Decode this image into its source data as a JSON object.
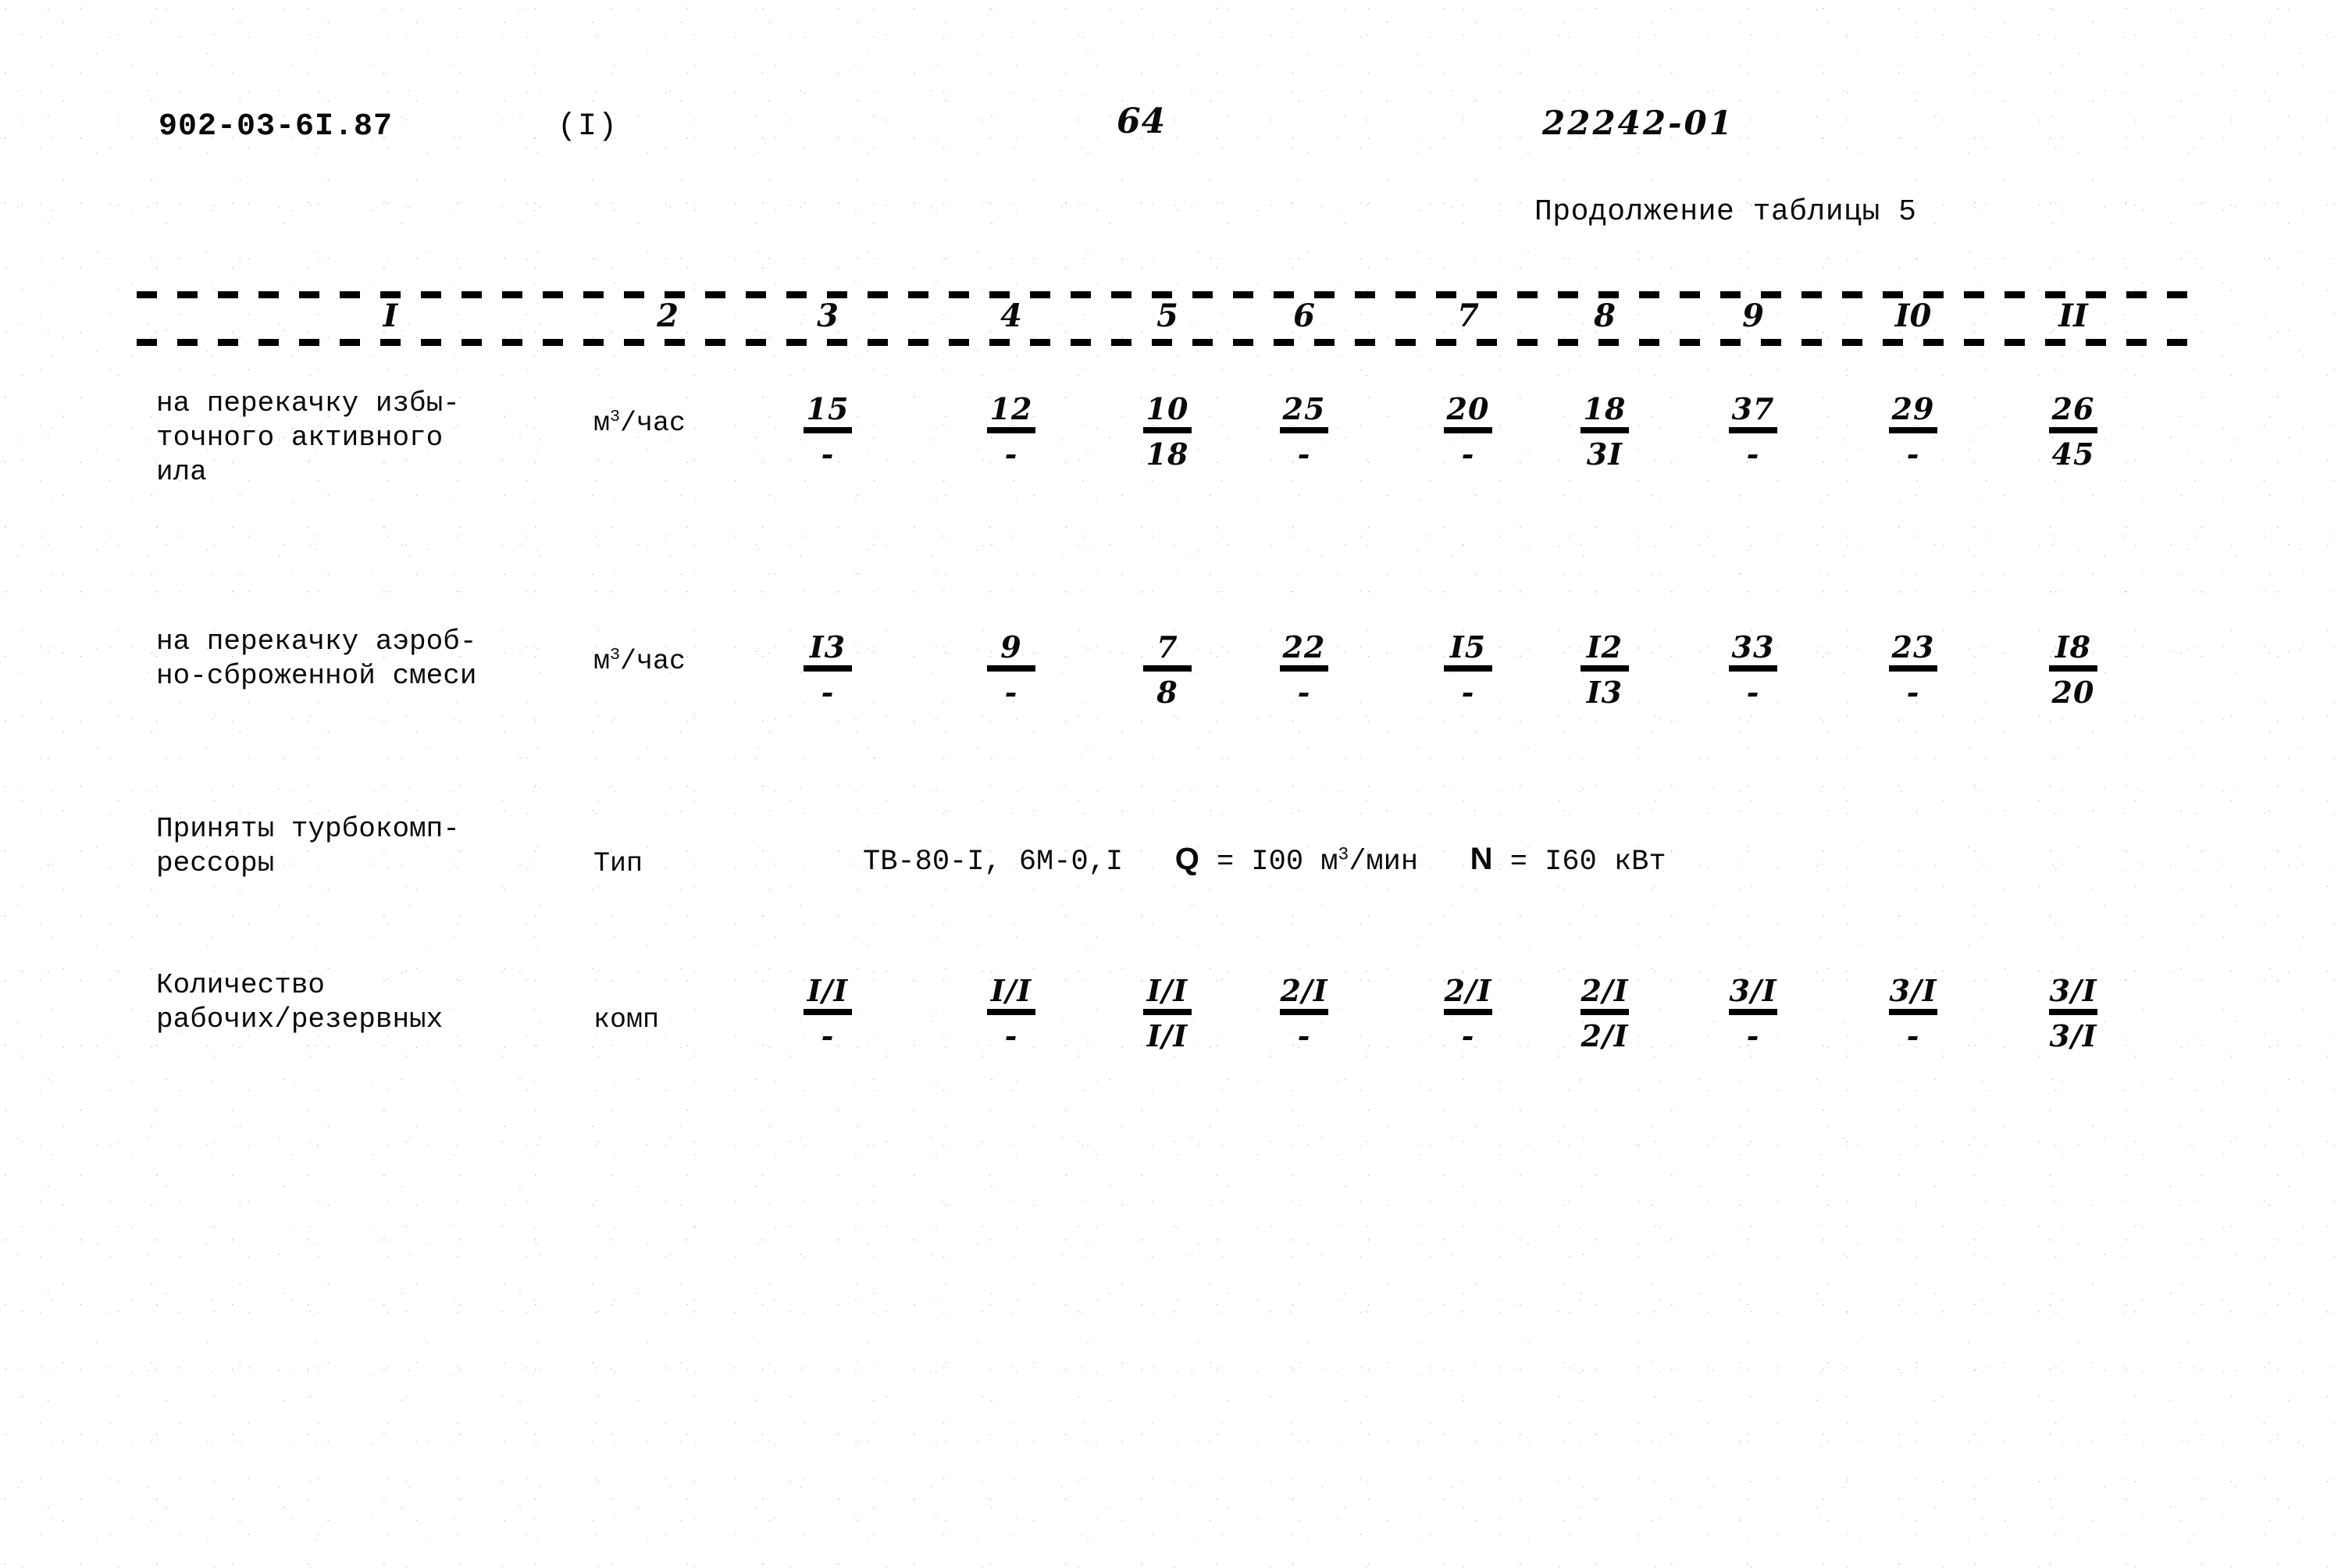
{
  "header": {
    "doc_code": "902-03-6I.87",
    "part_number": "(I)",
    "page_number": "64",
    "drawing_number": "22242-01",
    "table_continuation": "Продолжение таблицы 5"
  },
  "table": {
    "column_numbers": [
      "I",
      "2",
      "3",
      "4",
      "5",
      "6",
      "7",
      "8",
      "9",
      "I0",
      "II"
    ],
    "rows": [
      {
        "label": "на перекачку избы-\nточного активного\nила",
        "unit_base": "м",
        "unit_sup": "3",
        "unit_rest": "/час",
        "cells": [
          {
            "num": "15",
            "den": "-"
          },
          {
            "num": "12",
            "den": "-"
          },
          {
            "num": "10",
            "den": "18"
          },
          {
            "num": "25",
            "den": "-"
          },
          {
            "num": "20",
            "den": "-"
          },
          {
            "num": "18",
            "den": "3I"
          },
          {
            "num": "37",
            "den": "-"
          },
          {
            "num": "29",
            "den": "-"
          },
          {
            "num": "26",
            "den": "45"
          }
        ]
      },
      {
        "label": "на перекачку аэроб-\nно-сброженной смеси",
        "unit_base": "м",
        "unit_sup": "3",
        "unit_rest": "/час",
        "cells": [
          {
            "num": "I3",
            "den": "-"
          },
          {
            "num": "9",
            "den": "-"
          },
          {
            "num": "7",
            "den": "8"
          },
          {
            "num": "22",
            "den": "-"
          },
          {
            "num": "I5",
            "den": "-"
          },
          {
            "num": "I2",
            "den": "I3"
          },
          {
            "num": "33",
            "den": "-"
          },
          {
            "num": "23",
            "den": "-"
          },
          {
            "num": "I8",
            "den": "20"
          }
        ]
      },
      {
        "label": "Приняты турбокомп-\nрессоры",
        "unit_base": "Тип",
        "unit_sup": "",
        "unit_rest": "",
        "span_text": {
          "type": "ТВ-80-I, 6М-0,I",
          "q_symbol": "Q",
          "q_eq": "= I00 м",
          "q_sup": "3",
          "q_rest": "/мин",
          "n_symbol": "N",
          "n_eq": "= I60 кВт"
        },
        "cells": []
      },
      {
        "label": "Количество\nрабочих/резервных",
        "unit_base": "комп",
        "unit_sup": "",
        "unit_rest": "",
        "cells": [
          {
            "num": "I/I",
            "den": "-"
          },
          {
            "num": "I/I",
            "den": "-"
          },
          {
            "num": "I/I",
            "den": "I/I"
          },
          {
            "num": "2/I",
            "den": "-"
          },
          {
            "num": "2/I",
            "den": "-"
          },
          {
            "num": "2/I",
            "den": "2/I"
          },
          {
            "num": "3/I",
            "den": "-"
          },
          {
            "num": "3/I",
            "den": "-"
          },
          {
            "num": "3/I",
            "den": "3/I"
          }
        ]
      }
    ]
  }
}
